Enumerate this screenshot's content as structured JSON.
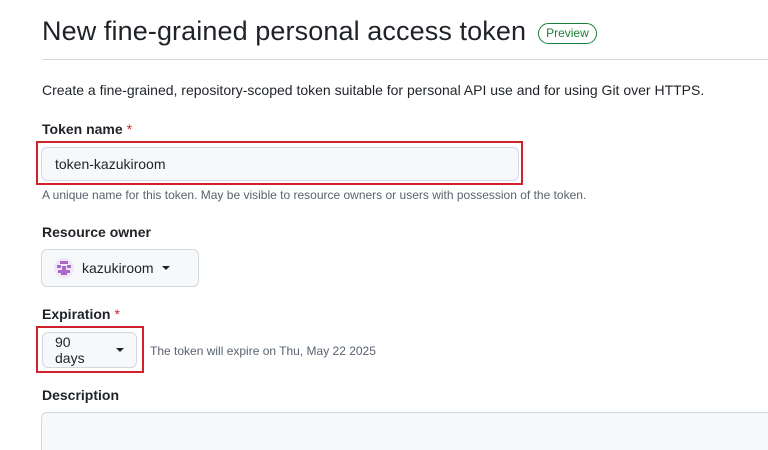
{
  "header": {
    "title": "New fine-grained personal access token",
    "badge": "Preview"
  },
  "intro_text": "Create a fine-grained, repository-scoped token suitable for personal API use and for using Git over HTTPS.",
  "token_name": {
    "label": "Token name",
    "required_marker": "*",
    "value": "token-kazukiroom",
    "hint": "A unique name for this token. May be visible to resource owners or users with possession of the token."
  },
  "resource_owner": {
    "label": "Resource owner",
    "selected": "kazukiroom",
    "avatar_icon": "identicon-avatar",
    "avatar_color": "#a768c7"
  },
  "expiration": {
    "label": "Expiration",
    "required_marker": "*",
    "selected": "90 days",
    "note": "The token will expire on Thu, May 22 2025"
  },
  "description": {
    "label": "Description",
    "value": ""
  },
  "colors": {
    "highlight": "#d0212d",
    "badge_green": "#1a7f37",
    "required_red": "#d1242f"
  }
}
